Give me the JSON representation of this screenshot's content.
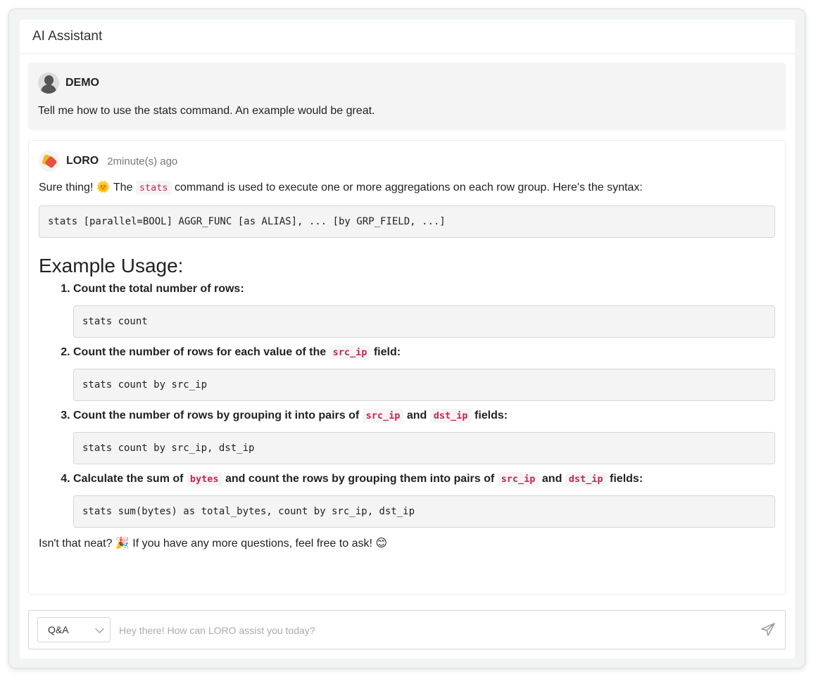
{
  "header": {
    "title": "AI Assistant"
  },
  "user_message": {
    "name": "DEMO",
    "text": "Tell me how to use the stats command. An example would be great."
  },
  "ai_message": {
    "name": "LORO",
    "time": "2minute(s) ago",
    "intro_before": "Sure thing! 🌞 The ",
    "intro_code": "stats",
    "intro_after": " command is used to execute one or more aggregations on each row group. Here's the syntax:",
    "syntax": "stats [parallel=BOOL] AGGR_FUNC [as ALIAS], ... [by GRP_FIELD, ...]",
    "section_title": "Example Usage:",
    "steps": [
      {
        "text": "Count the total number of rows:",
        "code": "stats count"
      },
      {
        "text_a": "Count the number of rows for each value of the ",
        "code_a": "src_ip",
        "text_b": " field:",
        "code": "stats count by src_ip"
      },
      {
        "text_a": "Count the number of rows by grouping it into pairs of ",
        "code_a": "src_ip",
        "text_b": " and ",
        "code_b": "dst_ip",
        "text_c": " fields:",
        "code": "stats count by src_ip, dst_ip"
      },
      {
        "text_a": "Calculate the sum of ",
        "code_a": "bytes",
        "text_b": " and count the rows by grouping them into pairs of ",
        "code_b": "src_ip",
        "text_c": " and ",
        "code_c": "dst_ip",
        "text_d": " fields:",
        "code": "stats sum(bytes) as total_bytes, count by src_ip, dst_ip"
      }
    ],
    "outro": "Isn't that neat? 🎉 If you have any more questions, feel free to ask! 😊"
  },
  "composer": {
    "mode": "Q&A",
    "placeholder": "Hey there! How can LORO assist you today?",
    "send_icon": "send-icon"
  }
}
